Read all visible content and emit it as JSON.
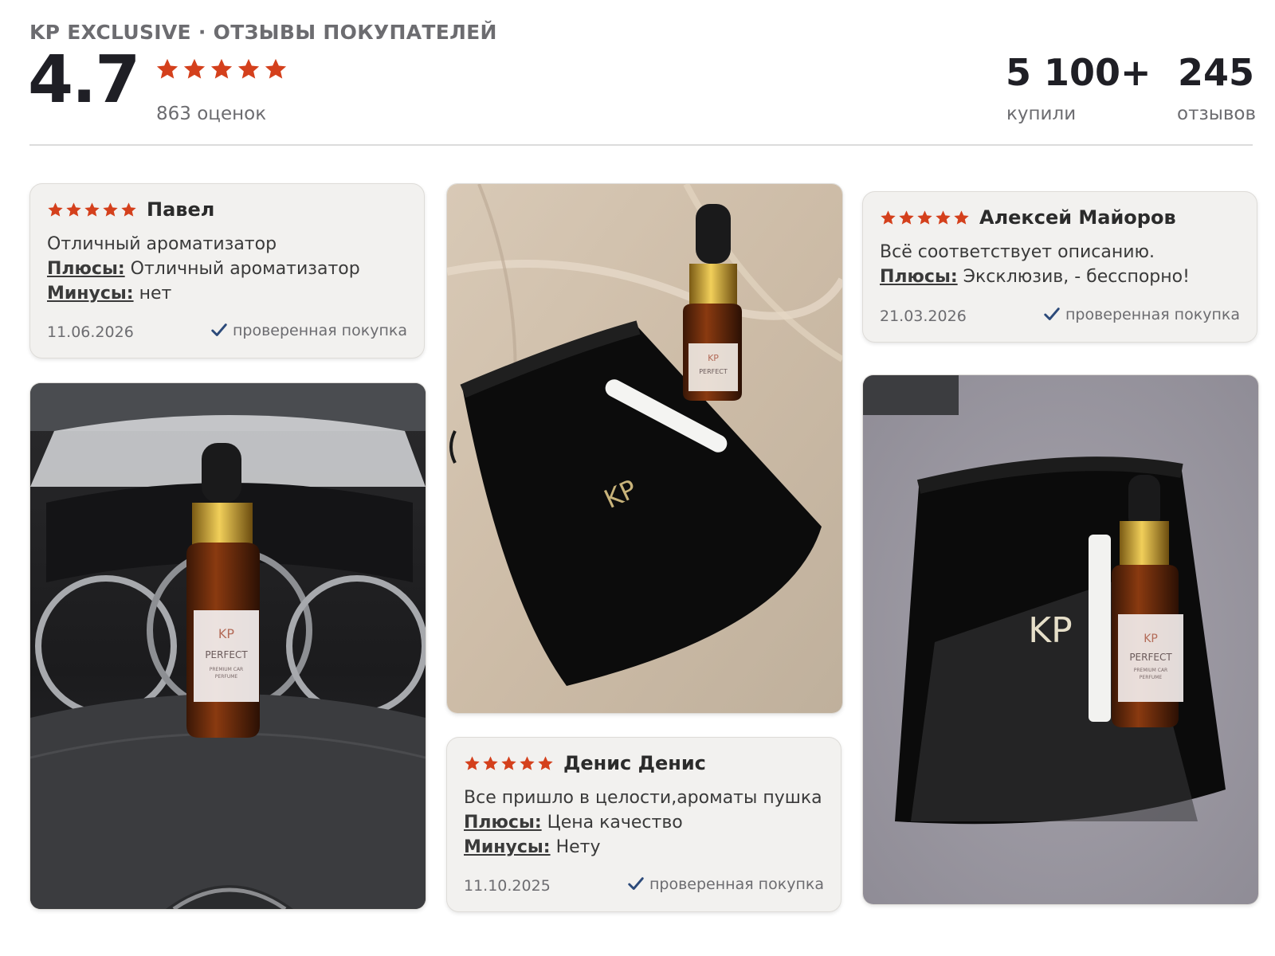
{
  "header": {
    "label": "KP EXCLUSIVE · ОТЗЫВЫ ПОКУПАТЕЛЕЙ",
    "rating": "4.7",
    "stars": 5,
    "ratings_count": "863 оценок",
    "stats": [
      {
        "value": "5 100+",
        "label": "купили"
      },
      {
        "value": "245",
        "label": "отзывов"
      }
    ]
  },
  "colors": {
    "star": "#d4401c",
    "check": "#2c4a7a"
  },
  "reviews": [
    {
      "author": "Павел",
      "stars": 5,
      "text": "Отличный ароматизатор",
      "pros_label": "Плюсы:",
      "pros": "Отличный ароматизатор",
      "cons_label": "Минусы:",
      "cons": "нет",
      "date": "11.06.2026",
      "verified": "проверенная покупка"
    },
    {
      "author": "Алексей Майоров",
      "stars": 5,
      "text": "Всё соответствует описанию.",
      "pros_label": "Плюсы:",
      "pros": "Эксклюзив, - бесспорно!",
      "date": "21.03.2026",
      "verified": "проверенная покупка"
    },
    {
      "author": "Денис Денис",
      "stars": 5,
      "text": "Все пришло в целости,ароматы пушка",
      "pros_label": "Плюсы:",
      "pros": "Цена качество",
      "cons_label": "Минусы:",
      "cons": "Нету",
      "date": "11.10.2025",
      "verified": "проверенная покупка"
    }
  ],
  "photos": [
    {
      "bottle_logo": "KP",
      "bottle_name": "PERFECT",
      "bottle_sub": "PREMIUM CAR",
      "bottle_sub2": "PERFUME"
    },
    {
      "bottle_logo": "KP",
      "bottle_name": "PERFECT",
      "bag_logo": "KP"
    },
    {
      "bottle_logo": "KP",
      "bottle_name": "PERFECT",
      "bottle_sub": "PREMIUM CAR",
      "bottle_sub2": "PERFUME",
      "bag_logo": "KP"
    }
  ]
}
